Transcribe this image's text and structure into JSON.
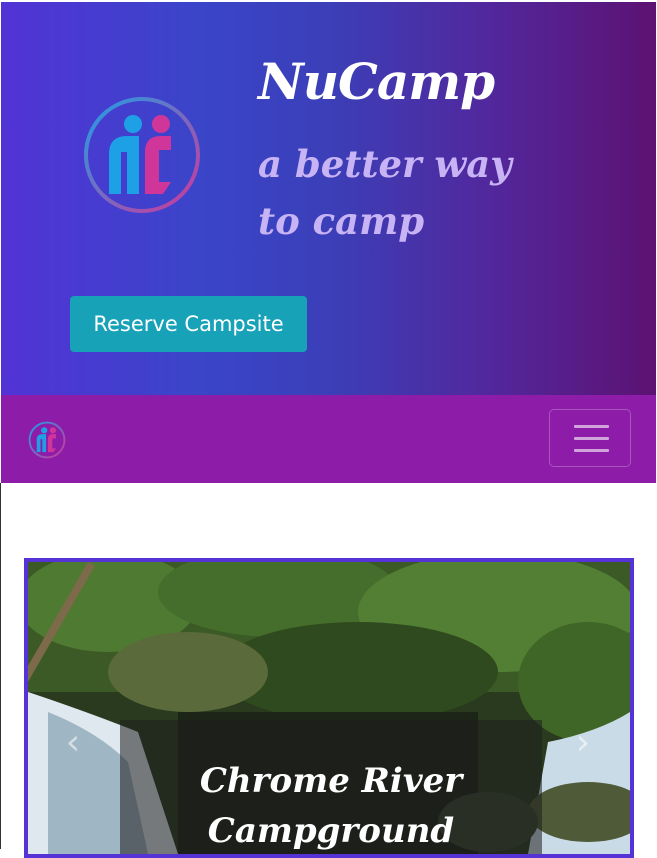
{
  "header": {
    "brand": "NuCamp",
    "tagline": "a better way to camp",
    "reserve_button": "Reserve Campsite",
    "logo_icon": "nucamp-logo-icon"
  },
  "navbar": {
    "logo_icon": "nucamp-logo-icon",
    "toggler_icon": "hamburger-icon"
  },
  "carousel": {
    "caption": "Chrome River Campground",
    "prev_icon": "chevron-left-icon",
    "next_icon": "chevron-right-icon"
  },
  "colors": {
    "header_gradient_start": "#5233d6",
    "header_gradient_end": "#5c1272",
    "navbar": "#8d1ca8",
    "button": "#17a2b8",
    "carousel_border": "#5533d6",
    "tagline": "#c8b4f5"
  }
}
